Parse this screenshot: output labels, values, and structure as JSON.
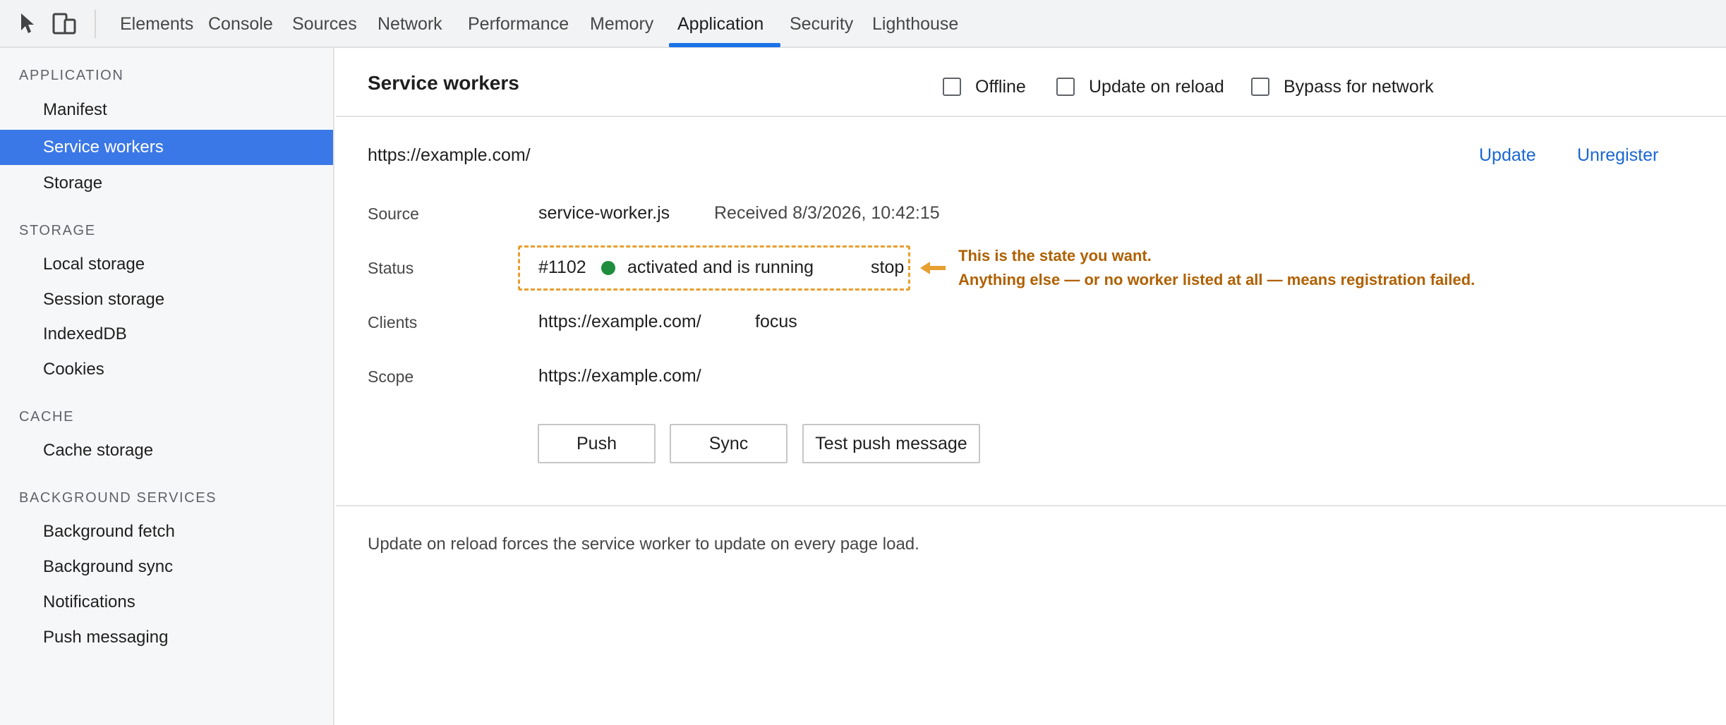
{
  "toolbar": {
    "icons": [
      "inspect-element-icon",
      "device-toolbar-icon"
    ],
    "tabs": [
      {
        "label": "Elements"
      },
      {
        "label": "Console"
      },
      {
        "label": "Sources"
      },
      {
        "label": "Network"
      },
      {
        "label": "Performance"
      },
      {
        "label": "Memory"
      },
      {
        "label": "Application"
      },
      {
        "label": "Security"
      },
      {
        "label": "Lighthouse"
      }
    ],
    "active_tab": "Application"
  },
  "sidebar": {
    "sections": [
      {
        "header": "APPLICATION",
        "items": [
          "Manifest",
          "Service workers",
          "Storage"
        ]
      },
      {
        "header": "STORAGE",
        "items": [
          "Local storage",
          "Session storage",
          "IndexedDB",
          "Cookies"
        ]
      },
      {
        "header": "CACHE",
        "items": [
          "Cache storage"
        ]
      },
      {
        "header": "BACKGROUND SERVICES",
        "items": [
          "Background fetch",
          "Background sync",
          "Notifications",
          "Push messaging"
        ]
      }
    ],
    "selected": "Service workers"
  },
  "panel": {
    "title": "Service workers",
    "options": {
      "offline": "Offline",
      "update_on_reload": "Update on reload",
      "bypass_for_network": "Bypass for network"
    }
  },
  "worker": {
    "origin": "https://example.com/",
    "update_label": "Update",
    "unregister_label": "Unregister",
    "source_label": "Source",
    "source_file": "service-worker.js",
    "received": "Received 8/3/2026, 10:42:15",
    "status_label": "Status",
    "status_id": "#1102",
    "status_text": "activated and is running",
    "stop_label": "stop",
    "clients_label": "Clients",
    "client_url": "https://example.com/",
    "focus_label": "focus",
    "scope_label": "Scope",
    "scope_url": "https://example.com/",
    "buttons": {
      "push": "Push",
      "sync": "Sync",
      "test_push": "Test push message"
    }
  },
  "annotation": {
    "line1": "This is the state you want.",
    "line2": "Anything else — or no worker listed at all — means registration failed."
  },
  "footnote": "Update on reload forces the service worker to update on every page load.",
  "colors": {
    "accent": "#1a73e8",
    "sidebar_selected": "#3b78e7",
    "link": "#1a67d2",
    "running_dot": "#1e8e3e",
    "annotation": "#b06000",
    "annotation_border": "#e6a030"
  }
}
